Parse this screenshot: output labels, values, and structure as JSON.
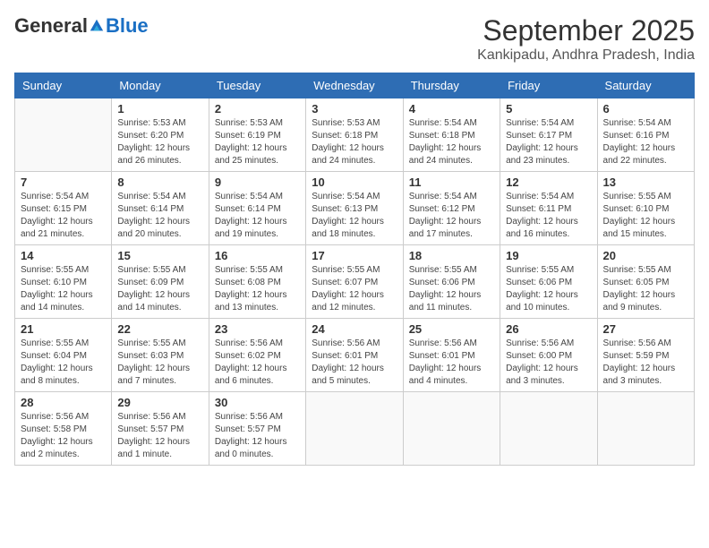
{
  "header": {
    "logo": {
      "general": "General",
      "blue": "Blue"
    },
    "title": "September 2025",
    "location": "Kankipadu, Andhra Pradesh, India"
  },
  "days_of_week": [
    "Sunday",
    "Monday",
    "Tuesday",
    "Wednesday",
    "Thursday",
    "Friday",
    "Saturday"
  ],
  "weeks": [
    [
      {
        "day": "",
        "sunrise": "",
        "sunset": "",
        "daylight": ""
      },
      {
        "day": "1",
        "sunrise": "Sunrise: 5:53 AM",
        "sunset": "Sunset: 6:20 PM",
        "daylight": "Daylight: 12 hours and 26 minutes."
      },
      {
        "day": "2",
        "sunrise": "Sunrise: 5:53 AM",
        "sunset": "Sunset: 6:19 PM",
        "daylight": "Daylight: 12 hours and 25 minutes."
      },
      {
        "day": "3",
        "sunrise": "Sunrise: 5:53 AM",
        "sunset": "Sunset: 6:18 PM",
        "daylight": "Daylight: 12 hours and 24 minutes."
      },
      {
        "day": "4",
        "sunrise": "Sunrise: 5:54 AM",
        "sunset": "Sunset: 6:18 PM",
        "daylight": "Daylight: 12 hours and 24 minutes."
      },
      {
        "day": "5",
        "sunrise": "Sunrise: 5:54 AM",
        "sunset": "Sunset: 6:17 PM",
        "daylight": "Daylight: 12 hours and 23 minutes."
      },
      {
        "day": "6",
        "sunrise": "Sunrise: 5:54 AM",
        "sunset": "Sunset: 6:16 PM",
        "daylight": "Daylight: 12 hours and 22 minutes."
      }
    ],
    [
      {
        "day": "7",
        "sunrise": "Sunrise: 5:54 AM",
        "sunset": "Sunset: 6:15 PM",
        "daylight": "Daylight: 12 hours and 21 minutes."
      },
      {
        "day": "8",
        "sunrise": "Sunrise: 5:54 AM",
        "sunset": "Sunset: 6:14 PM",
        "daylight": "Daylight: 12 hours and 20 minutes."
      },
      {
        "day": "9",
        "sunrise": "Sunrise: 5:54 AM",
        "sunset": "Sunset: 6:14 PM",
        "daylight": "Daylight: 12 hours and 19 minutes."
      },
      {
        "day": "10",
        "sunrise": "Sunrise: 5:54 AM",
        "sunset": "Sunset: 6:13 PM",
        "daylight": "Daylight: 12 hours and 18 minutes."
      },
      {
        "day": "11",
        "sunrise": "Sunrise: 5:54 AM",
        "sunset": "Sunset: 6:12 PM",
        "daylight": "Daylight: 12 hours and 17 minutes."
      },
      {
        "day": "12",
        "sunrise": "Sunrise: 5:54 AM",
        "sunset": "Sunset: 6:11 PM",
        "daylight": "Daylight: 12 hours and 16 minutes."
      },
      {
        "day": "13",
        "sunrise": "Sunrise: 5:55 AM",
        "sunset": "Sunset: 6:10 PM",
        "daylight": "Daylight: 12 hours and 15 minutes."
      }
    ],
    [
      {
        "day": "14",
        "sunrise": "Sunrise: 5:55 AM",
        "sunset": "Sunset: 6:10 PM",
        "daylight": "Daylight: 12 hours and 14 minutes."
      },
      {
        "day": "15",
        "sunrise": "Sunrise: 5:55 AM",
        "sunset": "Sunset: 6:09 PM",
        "daylight": "Daylight: 12 hours and 14 minutes."
      },
      {
        "day": "16",
        "sunrise": "Sunrise: 5:55 AM",
        "sunset": "Sunset: 6:08 PM",
        "daylight": "Daylight: 12 hours and 13 minutes."
      },
      {
        "day": "17",
        "sunrise": "Sunrise: 5:55 AM",
        "sunset": "Sunset: 6:07 PM",
        "daylight": "Daylight: 12 hours and 12 minutes."
      },
      {
        "day": "18",
        "sunrise": "Sunrise: 5:55 AM",
        "sunset": "Sunset: 6:06 PM",
        "daylight": "Daylight: 12 hours and 11 minutes."
      },
      {
        "day": "19",
        "sunrise": "Sunrise: 5:55 AM",
        "sunset": "Sunset: 6:06 PM",
        "daylight": "Daylight: 12 hours and 10 minutes."
      },
      {
        "day": "20",
        "sunrise": "Sunrise: 5:55 AM",
        "sunset": "Sunset: 6:05 PM",
        "daylight": "Daylight: 12 hours and 9 minutes."
      }
    ],
    [
      {
        "day": "21",
        "sunrise": "Sunrise: 5:55 AM",
        "sunset": "Sunset: 6:04 PM",
        "daylight": "Daylight: 12 hours and 8 minutes."
      },
      {
        "day": "22",
        "sunrise": "Sunrise: 5:55 AM",
        "sunset": "Sunset: 6:03 PM",
        "daylight": "Daylight: 12 hours and 7 minutes."
      },
      {
        "day": "23",
        "sunrise": "Sunrise: 5:56 AM",
        "sunset": "Sunset: 6:02 PM",
        "daylight": "Daylight: 12 hours and 6 minutes."
      },
      {
        "day": "24",
        "sunrise": "Sunrise: 5:56 AM",
        "sunset": "Sunset: 6:01 PM",
        "daylight": "Daylight: 12 hours and 5 minutes."
      },
      {
        "day": "25",
        "sunrise": "Sunrise: 5:56 AM",
        "sunset": "Sunset: 6:01 PM",
        "daylight": "Daylight: 12 hours and 4 minutes."
      },
      {
        "day": "26",
        "sunrise": "Sunrise: 5:56 AM",
        "sunset": "Sunset: 6:00 PM",
        "daylight": "Daylight: 12 hours and 3 minutes."
      },
      {
        "day": "27",
        "sunrise": "Sunrise: 5:56 AM",
        "sunset": "Sunset: 5:59 PM",
        "daylight": "Daylight: 12 hours and 3 minutes."
      }
    ],
    [
      {
        "day": "28",
        "sunrise": "Sunrise: 5:56 AM",
        "sunset": "Sunset: 5:58 PM",
        "daylight": "Daylight: 12 hours and 2 minutes."
      },
      {
        "day": "29",
        "sunrise": "Sunrise: 5:56 AM",
        "sunset": "Sunset: 5:57 PM",
        "daylight": "Daylight: 12 hours and 1 minute."
      },
      {
        "day": "30",
        "sunrise": "Sunrise: 5:56 AM",
        "sunset": "Sunset: 5:57 PM",
        "daylight": "Daylight: 12 hours and 0 minutes."
      },
      {
        "day": "",
        "sunrise": "",
        "sunset": "",
        "daylight": ""
      },
      {
        "day": "",
        "sunrise": "",
        "sunset": "",
        "daylight": ""
      },
      {
        "day": "",
        "sunrise": "",
        "sunset": "",
        "daylight": ""
      },
      {
        "day": "",
        "sunrise": "",
        "sunset": "",
        "daylight": ""
      }
    ]
  ]
}
